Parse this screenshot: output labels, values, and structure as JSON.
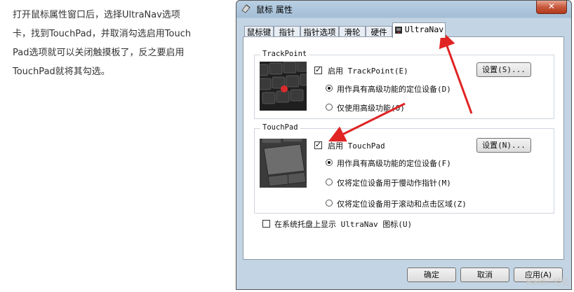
{
  "article": {
    "lines": [
      "打开鼠标属性窗口后，选择UltraNav选项",
      "卡，找到TouchPad，并取消勾选启用Touch",
      "Pad选项就可以关闭触摸板了，反之要启用",
      "TouchPad就将其勾选。"
    ]
  },
  "dialog": {
    "title": "鼠标 属性",
    "close_label": "✕",
    "tabs": [
      "鼠标键",
      "指针",
      "指针选项",
      "滑轮",
      "硬件",
      "UltraNav"
    ],
    "active_tab": "UltraNav",
    "trackpoint": {
      "group_label": "TrackPoint",
      "enable_label": "启用 TrackPoint(E)",
      "enable_checked": true,
      "settings_button": "设置(S)...",
      "option_advanced": "用作具有高级功能的定位设备(D)",
      "option_advanced_only": "仅使用高级功能(O)",
      "selected": "advanced"
    },
    "touchpad": {
      "group_label": "TouchPad",
      "enable_label": "启用 TouchPad",
      "enable_checked": true,
      "settings_button": "设置(N)...",
      "option_advanced": "用作具有高级功能的定位设备(F)",
      "option_slow_pointer": "仅将定位设备用于慢动作指针(M)",
      "option_scroll_click": "仅将定位设备用于滚动和点击区域(Z)",
      "selected": "advanced"
    },
    "tray_label": "在系统托盘上显示 UltraNav 图标(U)",
    "tray_checked": false,
    "buttons": {
      "ok": "确定",
      "cancel": "取消",
      "apply": "应用(A)"
    }
  },
  "watermark": "Baidu 经验",
  "colors": {
    "arrow": "#e02424",
    "titlebar": "#b9cfe2",
    "frame": "#c3d5e4"
  }
}
